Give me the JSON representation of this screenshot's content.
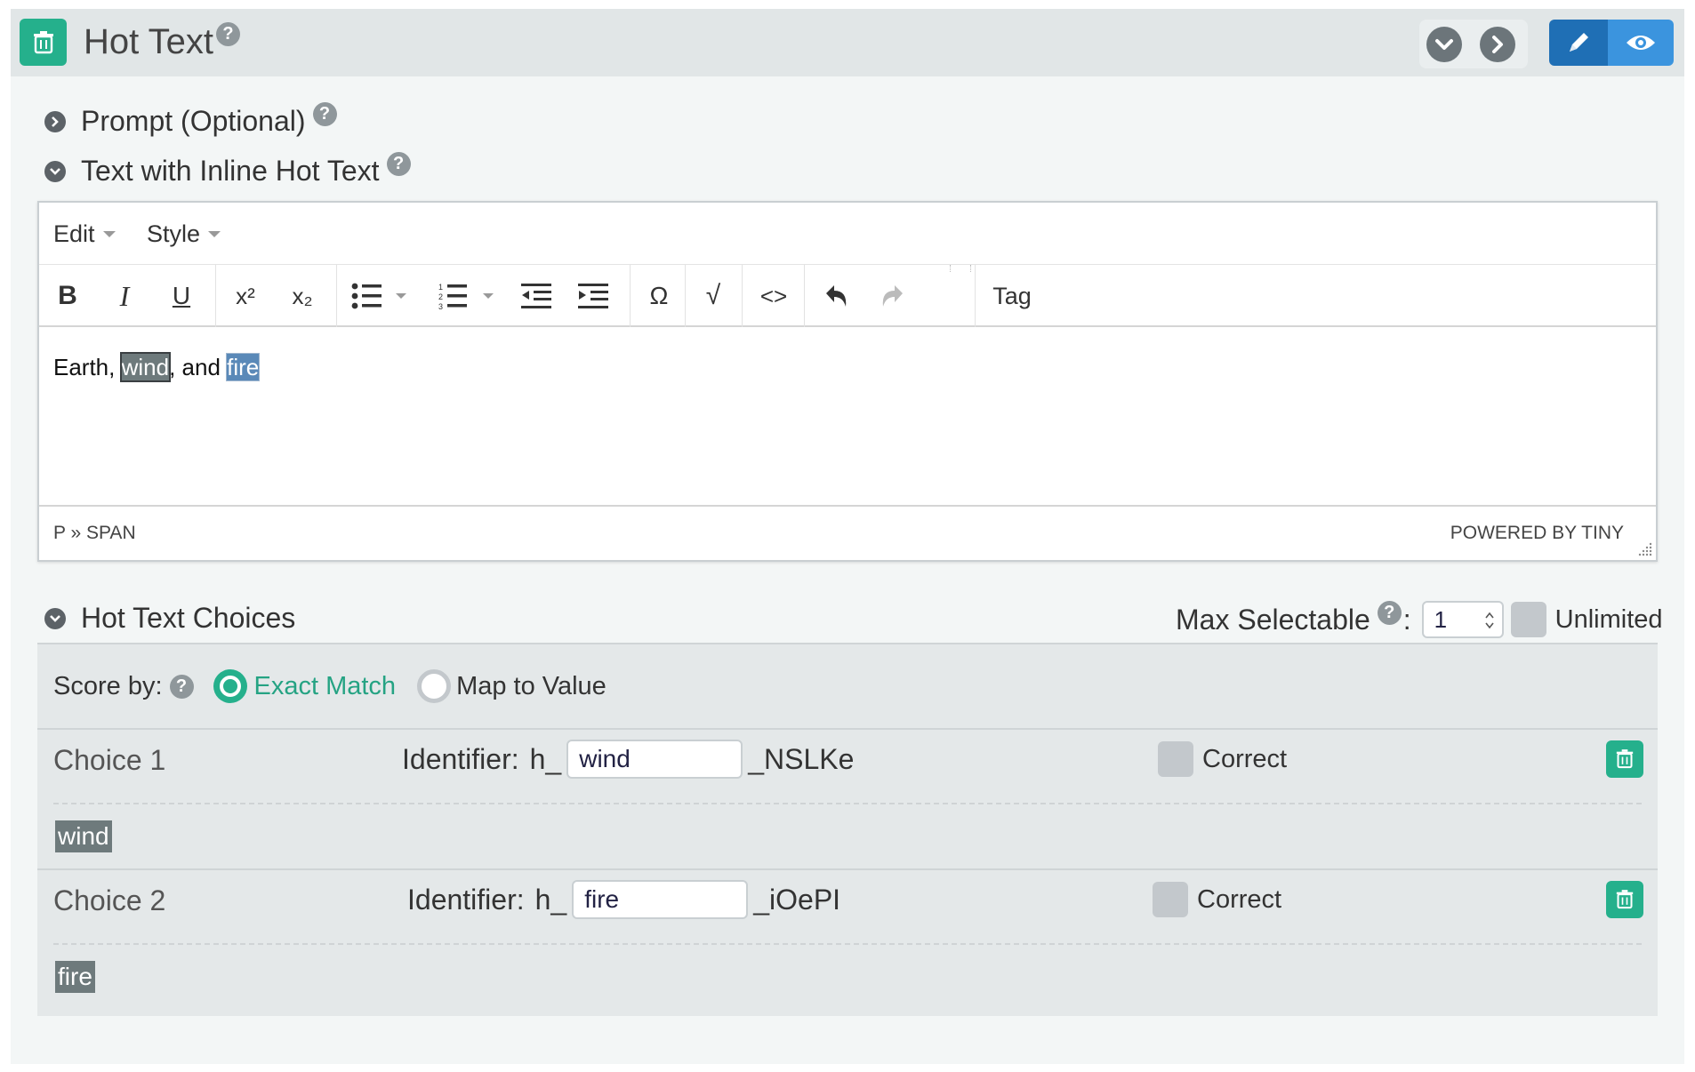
{
  "header": {
    "title": "Hot Text",
    "help": "?"
  },
  "sections": {
    "prompt": {
      "label": "Prompt (Optional)",
      "help": "?"
    },
    "text": {
      "label": "Text with Inline Hot Text",
      "help": "?"
    }
  },
  "editor": {
    "menus": [
      "Edit",
      "Style"
    ],
    "toolbar": {
      "bold": "B",
      "italic": "I",
      "underline": "U",
      "superscript": "x²",
      "subscript": "x₂",
      "omega": "Ω",
      "sqrt": "√",
      "code": "<>",
      "tag": "Tag"
    },
    "content": {
      "t1": "Earth, ",
      "hl1": "wind",
      "t2": ", and ",
      "hl2": "fire"
    },
    "statusbar": {
      "path": "P » SPAN",
      "powered": "POWERED BY TINY"
    }
  },
  "choices_section": {
    "title": "Hot Text Choices",
    "max_label": "Max Selectable",
    "max_help": "?",
    "colon": ":",
    "max_value": "1",
    "unlimited": "Unlimited",
    "score_by": "Score by:",
    "score_help": "?",
    "options": [
      "Exact Match",
      "Map to Value"
    ],
    "selected_option": "Exact Match",
    "items": [
      {
        "label": "Choice 1",
        "identifier_label": "Identifier:",
        "prefix": "h_",
        "value": "wind",
        "suffix": "_NSLKe",
        "correct_label": "Correct",
        "correct": false,
        "text": "wind"
      },
      {
        "label": "Choice 2",
        "identifier_label": "Identifier:",
        "prefix": "h_",
        "value": "fire",
        "suffix": "_iOePI",
        "correct_label": "Correct",
        "correct": false,
        "text": "fire"
      }
    ]
  },
  "colors": {
    "accent": "#25b08c",
    "primary_blue": "#2f86d1",
    "header_bg": "#e1e6e7"
  }
}
